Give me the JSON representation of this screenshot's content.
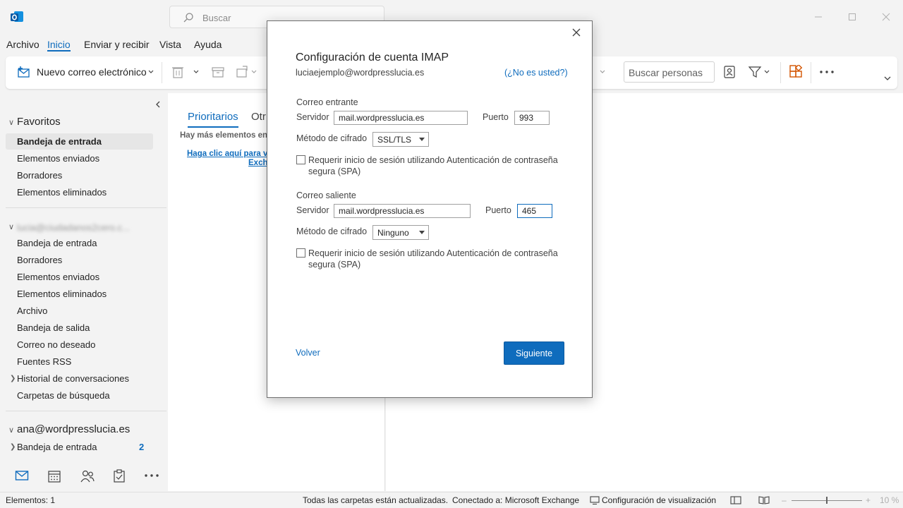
{
  "titlebar": {
    "search_placeholder": "Buscar"
  },
  "menu": {
    "items": [
      "Archivo",
      "Inicio",
      "Enviar y recibir",
      "Vista",
      "Ayuda"
    ],
    "active": "Inicio"
  },
  "ribbon": {
    "new_mail_label": "Nuevo correo electrónico",
    "people_search_placeholder": "Buscar personas"
  },
  "folders": {
    "favorites": {
      "title": "Favoritos",
      "items": [
        "Bandeja de entrada",
        "Elementos enviados",
        "Borradores",
        "Elementos eliminados"
      ],
      "selected": "Bandeja de entrada"
    },
    "account1": {
      "title": "lucia@ciudadanos2cero.c...",
      "items": [
        "Bandeja de entrada",
        "Borradores",
        "Elementos enviados",
        "Elementos eliminados",
        "Archivo",
        "Bandeja de salida",
        "Correo no deseado",
        "Fuentes RSS",
        "Historial de conversaciones",
        "Carpetas de búsqueda"
      ]
    },
    "account2": {
      "title": "ana@wordpresslucia.es",
      "items": [
        "Bandeja de entrada"
      ],
      "unread": "2"
    }
  },
  "message_list": {
    "tab_focused": "Prioritarios",
    "tab_other": "Otr",
    "more_info": "Hay más elementos en e",
    "exchange_link_line1": "Haga clic aquí para ve",
    "exchange_link_line2": "Exch"
  },
  "statusbar": {
    "items_count": "Elementos: 1",
    "folders_status": "Todas las carpetas están actualizadas.",
    "connected": "Conectado a: Microsoft Exchange",
    "display_settings": "Configuración de visualización",
    "zoom": "10 %"
  },
  "dialog": {
    "title": "Configuración de cuenta IMAP",
    "email": "luciaejemplo@wordpresslucia.es",
    "not_you": "(¿No es usted?)",
    "incoming": {
      "section": "Correo entrante",
      "server_label": "Servidor",
      "server_value": "mail.wordpresslucia.es",
      "port_label": "Puerto",
      "port_value": "993",
      "encryption_label": "Método de cifrado",
      "encryption_value": "SSL/TLS",
      "spa_label": "Requerir inicio de sesión utilizando Autenticación de contraseña segura (SPA)"
    },
    "outgoing": {
      "section": "Correo saliente",
      "server_label": "Servidor",
      "server_value": "mail.wordpresslucia.es",
      "port_label": "Puerto",
      "port_value": "465",
      "encryption_label": "Método de cifrado",
      "encryption_value": "Ninguno",
      "spa_label": "Requerir inicio de sesión utilizando Autenticación de contraseña segura (SPA)"
    },
    "back_label": "Volver",
    "next_label": "Siguiente"
  },
  "colors": {
    "accent": "#0f6cbd",
    "background": "#f3f3f3"
  }
}
